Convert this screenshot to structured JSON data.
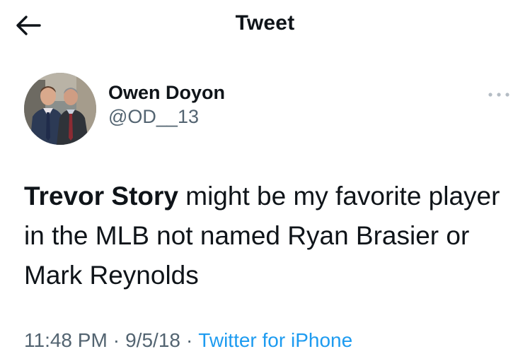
{
  "header": {
    "title": "Tweet",
    "back_icon": "arrow-left-icon"
  },
  "author": {
    "display_name": "Owen Doyon",
    "handle": "@OD__13",
    "avatar_icon": "avatar-photo"
  },
  "more_icon": "more-horizontal-icon",
  "tweet": {
    "highlight": "Trevor Story",
    "text": " might be my favorite player in the MLB not named Ryan Brasier or Mark Reynolds"
  },
  "meta": {
    "time": "11:48 PM",
    "separator": "·",
    "date": "9/5/18",
    "source": "Twitter for iPhone"
  },
  "colors": {
    "text": "#0f1419",
    "secondary": "#536471",
    "link": "#1d9bf0"
  }
}
